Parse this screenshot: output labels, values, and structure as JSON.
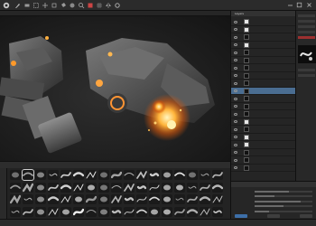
{
  "layers": {
    "title": "Layers",
    "items": [
      {
        "label": "",
        "thumb": "light"
      },
      {
        "label": "",
        "thumb": "light"
      },
      {
        "label": "",
        "thumb": "dark"
      },
      {
        "label": "",
        "thumb": "light"
      },
      {
        "label": "",
        "thumb": "dark"
      },
      {
        "label": "",
        "thumb": "dark"
      },
      {
        "label": "",
        "thumb": "dark"
      },
      {
        "label": "",
        "thumb": "dark"
      },
      {
        "label": "",
        "thumb": "dark"
      },
      {
        "label": "",
        "thumb": "dark",
        "selected": true
      },
      {
        "label": "",
        "thumb": "dark"
      },
      {
        "label": "",
        "thumb": "dark"
      },
      {
        "label": "",
        "thumb": "dark"
      },
      {
        "label": "",
        "thumb": "light"
      },
      {
        "label": "",
        "thumb": "dark"
      },
      {
        "label": "",
        "thumb": "light"
      },
      {
        "label": "",
        "thumb": "light"
      },
      {
        "label": "",
        "thumb": "dark"
      },
      {
        "label": "",
        "thumb": "dark"
      },
      {
        "label": "",
        "thumb": "dark"
      }
    ]
  },
  "settings": {
    "title": "",
    "rows": [
      {
        "label": "",
        "level": 0.6
      },
      {
        "label": "",
        "level": 0.35
      },
      {
        "label": "",
        "level": 0.8
      },
      {
        "label": "",
        "level": 0.5
      },
      {
        "label": "",
        "level": 0.25
      }
    ],
    "buttons": [
      "",
      "",
      ""
    ]
  },
  "colors": {
    "accent": "#4a6d91",
    "highlight": "#ff8a1c",
    "warning": "#9c3030"
  },
  "icons": {
    "menubar_left": [
      "app-logo-icon",
      "brush-tool-icon",
      "eraser-icon",
      "select-icon",
      "move-icon",
      "transform-icon",
      "fill-icon",
      "smudge-icon",
      "zoom-icon",
      "color-icon",
      "grid-icon",
      "symmetry-icon",
      "settings-icon"
    ],
    "window": [
      "minimize-icon",
      "maximize-icon",
      "close-icon"
    ]
  }
}
